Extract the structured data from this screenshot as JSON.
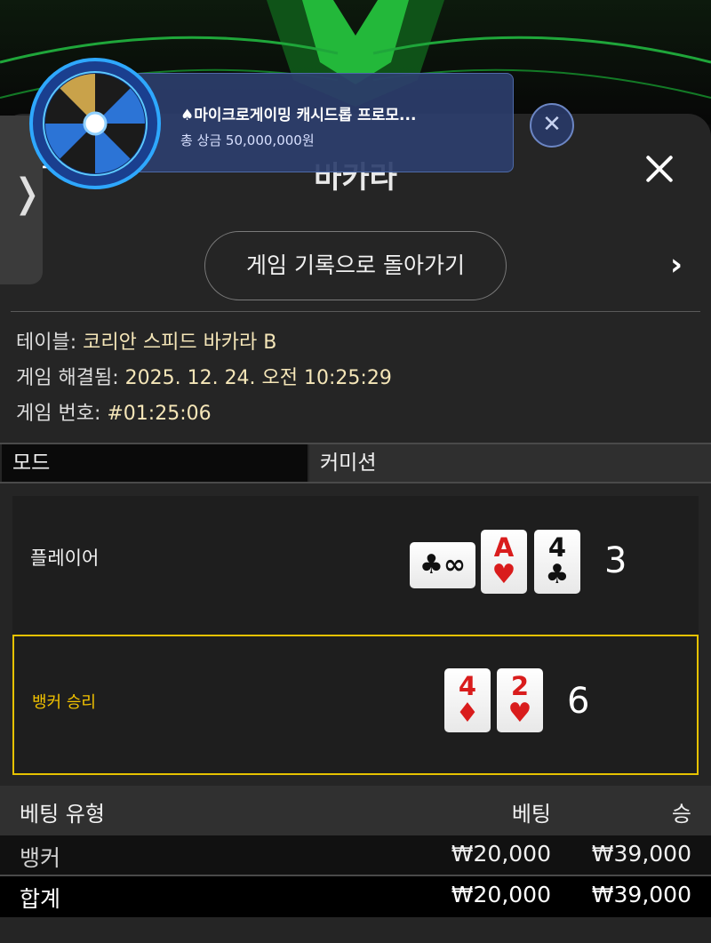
{
  "header": {
    "title": "바카라",
    "back_icon": "arrow-left-icon",
    "close_icon": "close-icon"
  },
  "nav": {
    "back_history_label": "게임 기록으로 돌아가기",
    "prev_icon": "chevron-left-icon",
    "next_icon": "chevron-right-icon"
  },
  "info": {
    "table_label": "테이블: ",
    "table_value": "코리안 스피드 바카라 B",
    "resolved_label": "게임 해결됨: ",
    "resolved_value": "2025. 12. 24. 오전 10:25:29",
    "number_label": "게임 번호: ",
    "number_value": "#01:25:06"
  },
  "mode": {
    "label": "모드",
    "value": "커미션"
  },
  "hands": {
    "player": {
      "label": "플레이어",
      "score": "3",
      "side_card": {
        "suit": "♣",
        "rank": "∞"
      },
      "cards": [
        {
          "rank": "A",
          "suit": "♥",
          "color": "red"
        },
        {
          "rank": "4",
          "suit": "♣",
          "color": "black"
        }
      ]
    },
    "banker": {
      "label": "뱅커 승리",
      "score": "6",
      "cards": [
        {
          "rank": "4",
          "suit": "♦",
          "color": "red"
        },
        {
          "rank": "2",
          "suit": "♥",
          "color": "red"
        }
      ]
    }
  },
  "bets": {
    "header": {
      "type": "베팅 유형",
      "bet": "베팅",
      "win": "승"
    },
    "rows": [
      {
        "type": "뱅커",
        "bet": "₩20,000",
        "win": "₩39,000"
      }
    ],
    "total": {
      "type": "합계",
      "bet": "₩20,000",
      "win": "₩39,000"
    }
  },
  "promo": {
    "title": "♠마이크로게이밍 캐시드롭 프로모...",
    "subtitle": "총 상금 50,000,000원",
    "icon": "prize-wheel-icon",
    "close_icon": "close-circle-icon"
  },
  "side_tab": {
    "icon": "chevron-right-icon"
  },
  "colors": {
    "accent_gold": "#e6c200",
    "card_red": "#d91c1c",
    "promo_bg": "#2d3e6c"
  }
}
